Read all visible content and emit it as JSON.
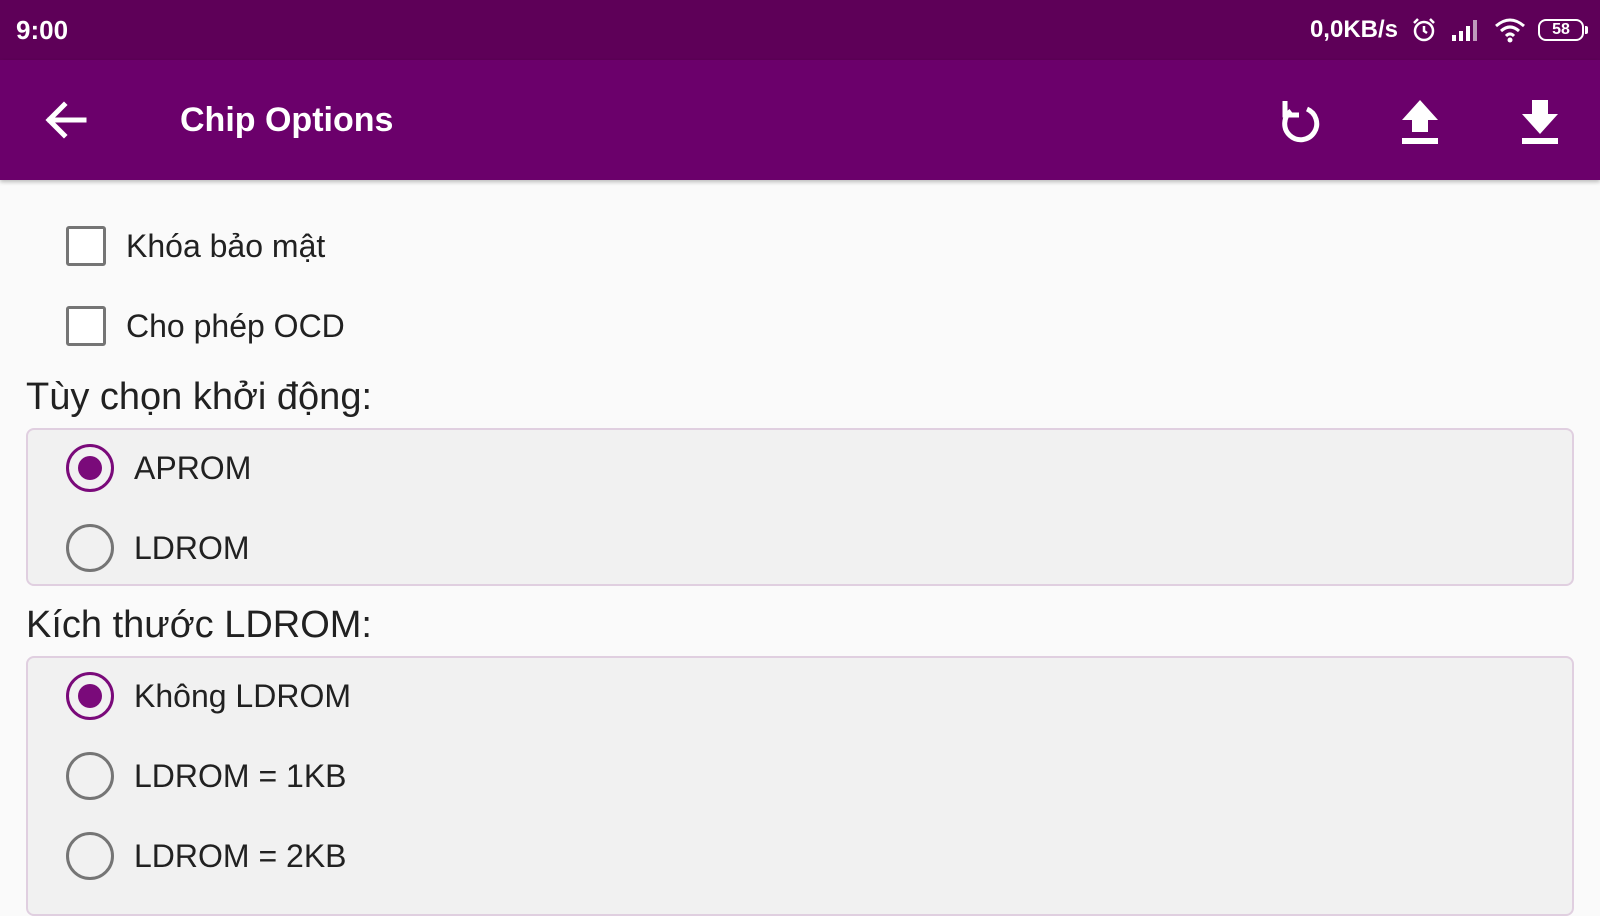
{
  "status_bar": {
    "time": "9:00",
    "net_speed": "0,0KB/s",
    "battery": "58",
    "icons": [
      "alarm-icon",
      "signal-icon",
      "wifi-icon",
      "battery-icon"
    ]
  },
  "app_bar": {
    "title": "Chip Options",
    "back_icon": "arrow-back-icon",
    "actions": [
      "refresh-icon",
      "upload-icon",
      "download-icon"
    ],
    "background": "#6b006b"
  },
  "checkboxes": [
    {
      "label": "Khóa bảo mật",
      "checked": false
    },
    {
      "label": "Cho phép OCD",
      "checked": false
    }
  ],
  "boot_section": {
    "title": "Tùy chọn khởi động:",
    "options": [
      {
        "label": "APROM",
        "selected": true
      },
      {
        "label": "LDROM",
        "selected": false
      }
    ]
  },
  "ldrom_size_section": {
    "title": "Kích thước LDROM:",
    "options": [
      {
        "label": "Không LDROM",
        "selected": true
      },
      {
        "label": "LDROM = 1KB",
        "selected": false
      },
      {
        "label": "LDROM = 2KB",
        "selected": false
      }
    ]
  },
  "colors": {
    "status_bar": "#5e0058",
    "accent": "#7a0a7a"
  }
}
